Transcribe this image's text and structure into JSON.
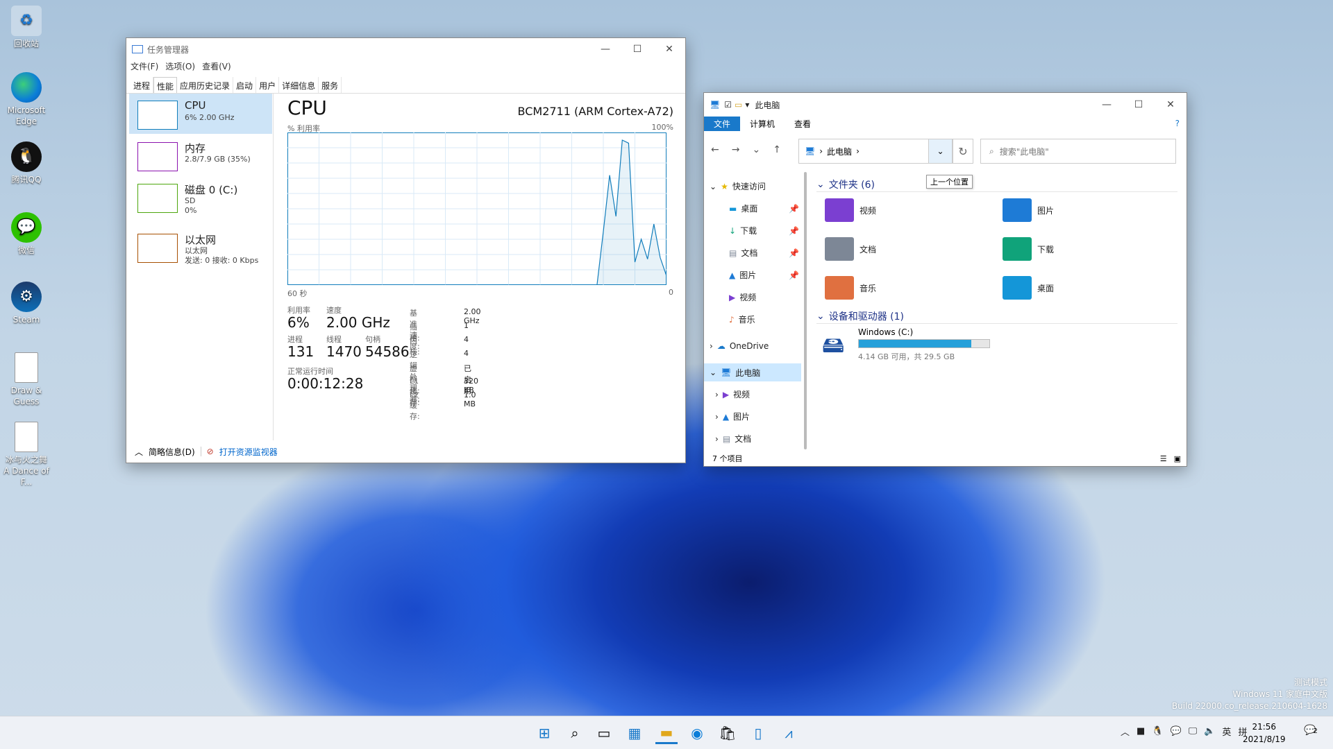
{
  "desktop": {
    "icons": [
      {
        "label": "回收站",
        "icon": "recycle-bin-icon"
      },
      {
        "label": "Microsoft Edge",
        "icon": "edge-icon"
      },
      {
        "label": "腾讯QQ",
        "icon": "qq-icon"
      },
      {
        "label": "微信",
        "icon": "wechat-icon"
      },
      {
        "label": "Steam",
        "icon": "steam-icon"
      },
      {
        "label": "Draw & Guess",
        "icon": "file-icon"
      },
      {
        "label": "冰与火之舞 A Dance of F...",
        "icon": "file-icon"
      }
    ],
    "watermark": [
      "测试模式",
      "Windows 11 家庭中文版",
      "Build 22000.co_release.210604-1628"
    ]
  },
  "task_manager": {
    "title": "任务管理器",
    "menu": [
      "文件(F)",
      "选项(O)",
      "查看(V)"
    ],
    "tabs": [
      "进程",
      "性能",
      "应用历史记录",
      "启动",
      "用户",
      "详细信息",
      "服务"
    ],
    "active_tab": "性能",
    "sidebar": [
      {
        "name": "CPU",
        "sub1": "6% 2.00 GHz",
        "sub2": "",
        "sub3": "",
        "color": "#117dbb"
      },
      {
        "name": "内存",
        "sub1": "2.8/7.9 GB (35%)",
        "sub2": "",
        "sub3": "",
        "color": "#8b12ae"
      },
      {
        "name": "磁盘 0 (C:)",
        "sub1": "SD",
        "sub2": "0%",
        "sub3": "",
        "color": "#4da60c"
      },
      {
        "name": "以太网",
        "sub1": "以太网",
        "sub2": "发送: 0 接收: 0 Kbps",
        "sub3": "",
        "color": "#a74f01"
      }
    ],
    "main": {
      "heading": "CPU",
      "model": "BCM2711 (ARM Cortex-A72)",
      "y_label": "% 利用率",
      "y_max_label": "100%",
      "x_left_label": "60 秒",
      "x_right_label": "0",
      "stats": {
        "utilization_label": "利用率",
        "utilization": "6%",
        "speed_label": "速度",
        "speed": "2.00 GHz",
        "processes_label": "进程",
        "processes": "131",
        "threads_label": "线程",
        "threads": "1470",
        "handles_label": "句柄",
        "handles": "54586",
        "uptime_label": "正常运行时间",
        "uptime": "0:00:12:28"
      },
      "details": [
        {
          "k": "基准速度:",
          "v": "2.00 GHz"
        },
        {
          "k": "插槽:",
          "v": "1"
        },
        {
          "k": "内核:",
          "v": "4"
        },
        {
          "k": "逻辑处理器:",
          "v": "4"
        },
        {
          "k": "虚拟化:",
          "v": "已启用"
        },
        {
          "k": "L1 缓存:",
          "v": "320 KB"
        },
        {
          "k": "L2 缓存:",
          "v": "1.0 MB"
        }
      ]
    },
    "footer": {
      "summary": "简略信息(D)",
      "monitor": "打开资源监视器"
    }
  },
  "chart_data": {
    "type": "area",
    "title": "CPU",
    "ylabel": "% 利用率",
    "xlabel": "",
    "x_range_label": [
      "60 秒",
      "0"
    ],
    "ylim": [
      0,
      100
    ],
    "x": [
      60,
      58,
      56,
      54,
      52,
      50,
      48,
      46,
      44,
      42,
      40,
      38,
      36,
      34,
      32,
      30,
      28,
      26,
      24,
      22,
      20,
      18,
      16,
      14,
      13,
      12,
      11,
      10,
      9,
      8,
      7,
      6,
      5,
      4,
      3,
      2,
      1,
      0
    ],
    "values": [
      0,
      0,
      0,
      0,
      0,
      0,
      0,
      0,
      0,
      0,
      0,
      0,
      0,
      0,
      0,
      0,
      0,
      0,
      0,
      0,
      0,
      0,
      0,
      0,
      0,
      0,
      0,
      0,
      0,
      0,
      0,
      0,
      0,
      0,
      0,
      0,
      0,
      0
    ],
    "series": [
      {
        "name": "CPU",
        "values": [
          0,
          0,
          0,
          0,
          0,
          0,
          0,
          0,
          0,
          0,
          0,
          0,
          0,
          0,
          0,
          0,
          0,
          0,
          0,
          0,
          0,
          0,
          0,
          0,
          0,
          0,
          0,
          35,
          72,
          45,
          95,
          93,
          15,
          30,
          17,
          40,
          18,
          6
        ]
      }
    ]
  },
  "explorer": {
    "title": "此电脑",
    "ribbon": [
      "文件",
      "计算机",
      "查看"
    ],
    "address": "此电脑",
    "search_placeholder": "搜索\"此电脑\"",
    "tooltip": "上一个位置",
    "nav": [
      {
        "label": "快速访问",
        "level": 0,
        "expanded": true
      },
      {
        "label": "桌面",
        "level": 1,
        "pinned": true
      },
      {
        "label": "下载",
        "level": 1,
        "pinned": true
      },
      {
        "label": "文档",
        "level": 1,
        "pinned": true
      },
      {
        "label": "图片",
        "level": 1,
        "pinned": true
      },
      {
        "label": "视频",
        "level": 1
      },
      {
        "label": "音乐",
        "level": 1
      },
      {
        "label": "OneDrive",
        "level": 0
      },
      {
        "label": "此电脑",
        "level": 0,
        "selected": true
      },
      {
        "label": "视频",
        "level": 1
      },
      {
        "label": "图片",
        "level": 1
      },
      {
        "label": "文档",
        "level": 1
      }
    ],
    "folders_header": "文件夹 (6)",
    "folders": [
      {
        "label": "视频",
        "color": "#7b3fd1"
      },
      {
        "label": "图片",
        "color": "#1e7bd6"
      },
      {
        "label": "文档",
        "color": "#7d8796"
      },
      {
        "label": "下载",
        "color": "#10a37a"
      },
      {
        "label": "音乐",
        "color": "#e07040"
      },
      {
        "label": "桌面",
        "color": "#1496d8"
      }
    ],
    "devices_header": "设备和驱动器 (1)",
    "drive": {
      "label": "Windows (C:)",
      "free_text": "4.14 GB 可用，共 29.5 GB",
      "used_fraction": 0.86
    },
    "status": "7 个项目"
  },
  "taskbar": {
    "time": "21:56",
    "date": "2021/8/19",
    "ime_lang": "英",
    "ime_mode": "拼",
    "notif_count": "2"
  }
}
